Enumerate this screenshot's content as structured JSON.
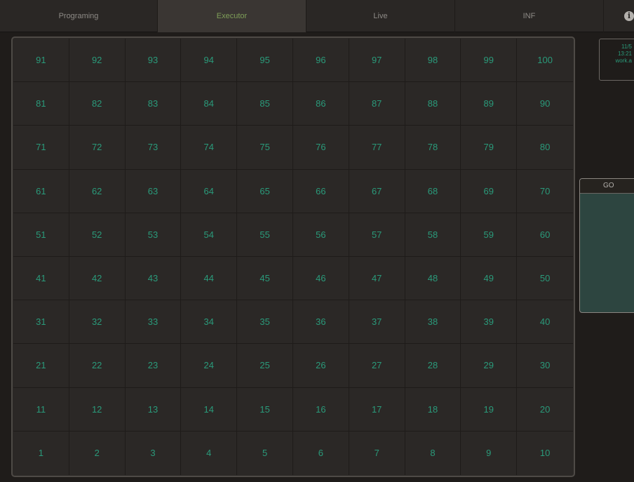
{
  "tabs": [
    {
      "label": "Programing"
    },
    {
      "label": "Executor"
    },
    {
      "label": "Live"
    },
    {
      "label": "INF"
    }
  ],
  "info_icon": {
    "glyph": "i"
  },
  "executors": [
    "91",
    "92",
    "93",
    "94",
    "95",
    "96",
    "97",
    "98",
    "99",
    "100",
    "81",
    "82",
    "83",
    "84",
    "85",
    "86",
    "87",
    "88",
    "89",
    "90",
    "71",
    "72",
    "73",
    "74",
    "75",
    "76",
    "77",
    "78",
    "79",
    "80",
    "61",
    "62",
    "63",
    "64",
    "65",
    "66",
    "67",
    "68",
    "69",
    "70",
    "51",
    "52",
    "53",
    "54",
    "55",
    "56",
    "57",
    "58",
    "59",
    "60",
    "41",
    "42",
    "43",
    "44",
    "45",
    "46",
    "47",
    "48",
    "49",
    "50",
    "31",
    "32",
    "33",
    "34",
    "35",
    "36",
    "37",
    "38",
    "39",
    "40",
    "21",
    "22",
    "23",
    "24",
    "25",
    "26",
    "27",
    "28",
    "29",
    "30",
    "11",
    "12",
    "13",
    "14",
    "15",
    "16",
    "17",
    "18",
    "19",
    "20",
    "1",
    "2",
    "3",
    "4",
    "5",
    "6",
    "7",
    "8",
    "9",
    "10"
  ],
  "status": {
    "line1": "11/5",
    "line2": "13:21",
    "line3": "work.a"
  },
  "go_panel": {
    "label": "GO"
  },
  "colors": {
    "accent_green": "#7e9e58",
    "executor_teal": "#2a9a7a",
    "go_fill": "#2d4540"
  }
}
